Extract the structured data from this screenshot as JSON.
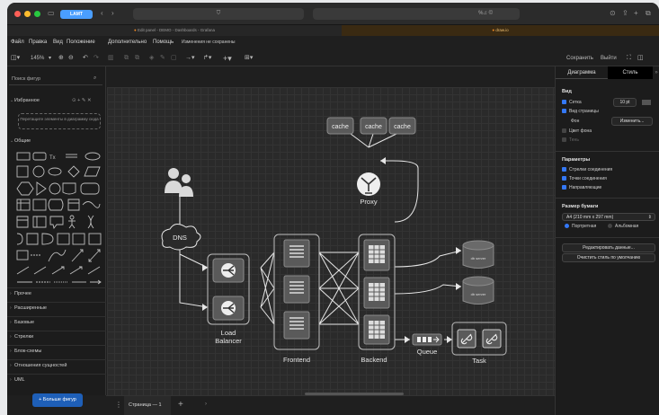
{
  "browser": {
    "tab_pill": "LAMT",
    "address": "",
    "tabs": [
      {
        "label": "Edit panel - DEMO - Dashboards - Grafana"
      },
      {
        "label": "draw.io"
      }
    ],
    "address_right": "%♫ ©"
  },
  "menu": {
    "items": [
      "Файл",
      "Правка",
      "Вид",
      "Положение",
      "Дополнительно",
      "Помощь"
    ],
    "unsaved": "Изменения не сохранены"
  },
  "toolbar": {
    "zoom": "145%",
    "save": "Сохранить",
    "exit": "Выйти"
  },
  "sidebar": {
    "search_placeholder": "Поиск фигур",
    "favorites": "Избранное",
    "drop_hint": "Перетащите элементы в диаграмму сюда",
    "general": "Общие",
    "sections": [
      "Прочее",
      "Расширенные",
      "Базовые",
      "Стрелки",
      "Блок-схемы",
      "Отношения сущностей",
      "UML"
    ],
    "more_shapes": "+ Больше фигур"
  },
  "pages": {
    "page_label": "Страница — 1"
  },
  "diagram": {
    "cache": [
      "cache",
      "cache",
      "cache"
    ],
    "proxy": "Proxy",
    "dns": "DNS",
    "load_balancer": "Load\nBalancer",
    "frontend": "Frontend",
    "backend": "Backend",
    "queue": "Queue",
    "task": "Task",
    "db_label": "db server"
  },
  "panel": {
    "tabs": [
      "Диаграмма",
      "Стиль"
    ],
    "view_header": "Вид",
    "grid": "Сетка",
    "grid_size": "10 pt",
    "page_view": "Вид страницы",
    "background": "Фон",
    "change": "Изменить...",
    "bg_color": "Цвет фона",
    "shadow": "Тень",
    "options_header": "Параметры",
    "opt1": "Стрелки соединения",
    "opt2": "Точки соединения",
    "opt3": "Направляющие",
    "paper_header": "Размер бумаги",
    "paper": "A4 (210 mm x 297 mm)",
    "portrait": "Портретная",
    "landscape": "Альбомная",
    "edit_data": "Редактировать данные...",
    "clear_style": "Очистить стиль по умолчанию"
  },
  "colors": {
    "accent": "#3478f6",
    "canvas": "#2a2a2a",
    "node": "#5a5a5a",
    "line": "#e6e6e6"
  }
}
